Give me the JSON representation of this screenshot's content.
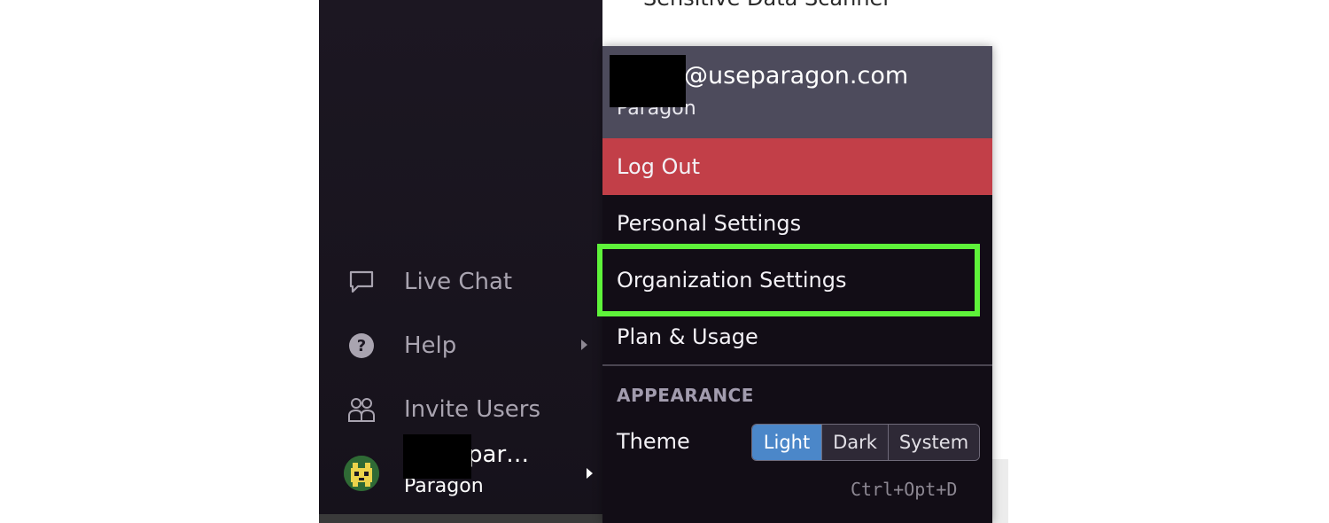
{
  "background": {
    "heading_text": "Sensitive Data Scanner"
  },
  "sidebar": {
    "items": [
      {
        "label": "Live Chat",
        "icon": "chat-bubble-icon"
      },
      {
        "label": "Help",
        "icon": "help-circle-icon"
      },
      {
        "label": "Invite Users",
        "icon": "users-icon"
      }
    ],
    "user": {
      "email": "@usepar…",
      "org": "Paragon",
      "icon": "avatar-icon"
    }
  },
  "menu": {
    "header_email": "@useparagon.com",
    "header_org": "Paragon",
    "logout_label": "Log Out",
    "personal_label": "Personal Settings",
    "org_label": "Organization Settings",
    "plan_label": "Plan & Usage",
    "appearance_title": "APPEARANCE",
    "theme_label": "Theme",
    "theme_options": [
      "Light",
      "Dark",
      "System"
    ],
    "theme_selected": "Light",
    "shortcut": "Ctrl+Opt+D"
  },
  "colors": {
    "sidebar_bg": "#1c1722",
    "menu_bg": "#120d16",
    "menu_header": "#4d4b5c",
    "logout": "#c23f48",
    "highlight": "#5ef33a",
    "toggle_selected": "#4b87c9"
  }
}
